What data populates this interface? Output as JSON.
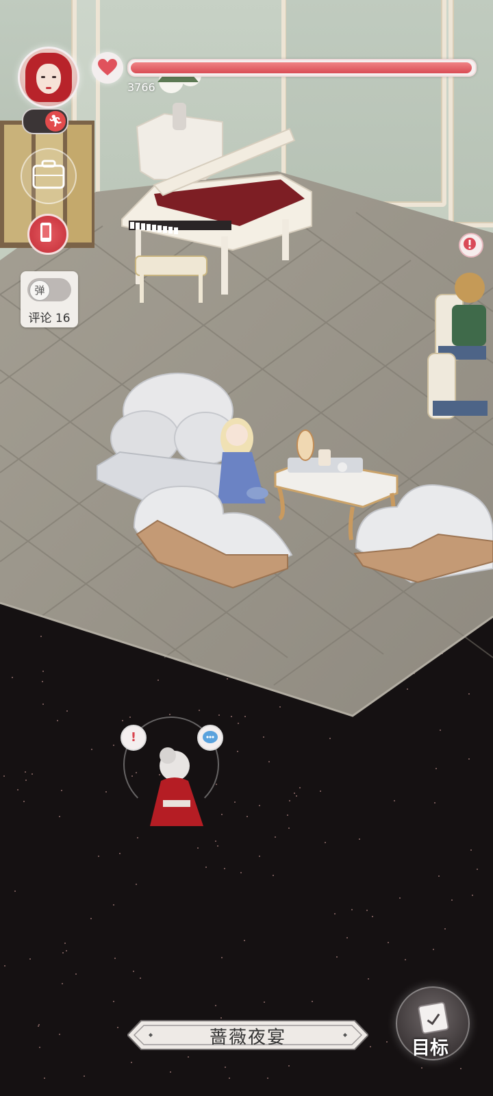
{
  "hud": {
    "hp_value": "3766",
    "hp_fraction": 0.995,
    "danmaku_toggle_label": "弹",
    "comment_label": "评论 16"
  },
  "icons": {
    "avatar": "player-avatar",
    "run": "running-person-icon",
    "heart": "heart-icon",
    "luggage": "suitcase-icon",
    "phone": "phone-icon",
    "alert": "exclamation-icon",
    "chat": "chat-bubble-icon",
    "goal": "calendar-check-icon"
  },
  "npc": {
    "alert_symbol": "!"
  },
  "scene": {
    "title": "蔷薇夜宴"
  },
  "goal": {
    "label": "目标"
  },
  "colors": {
    "hp_fill": "#e05a60",
    "accent_red": "#d63c45",
    "space_bg": "#151112"
  }
}
